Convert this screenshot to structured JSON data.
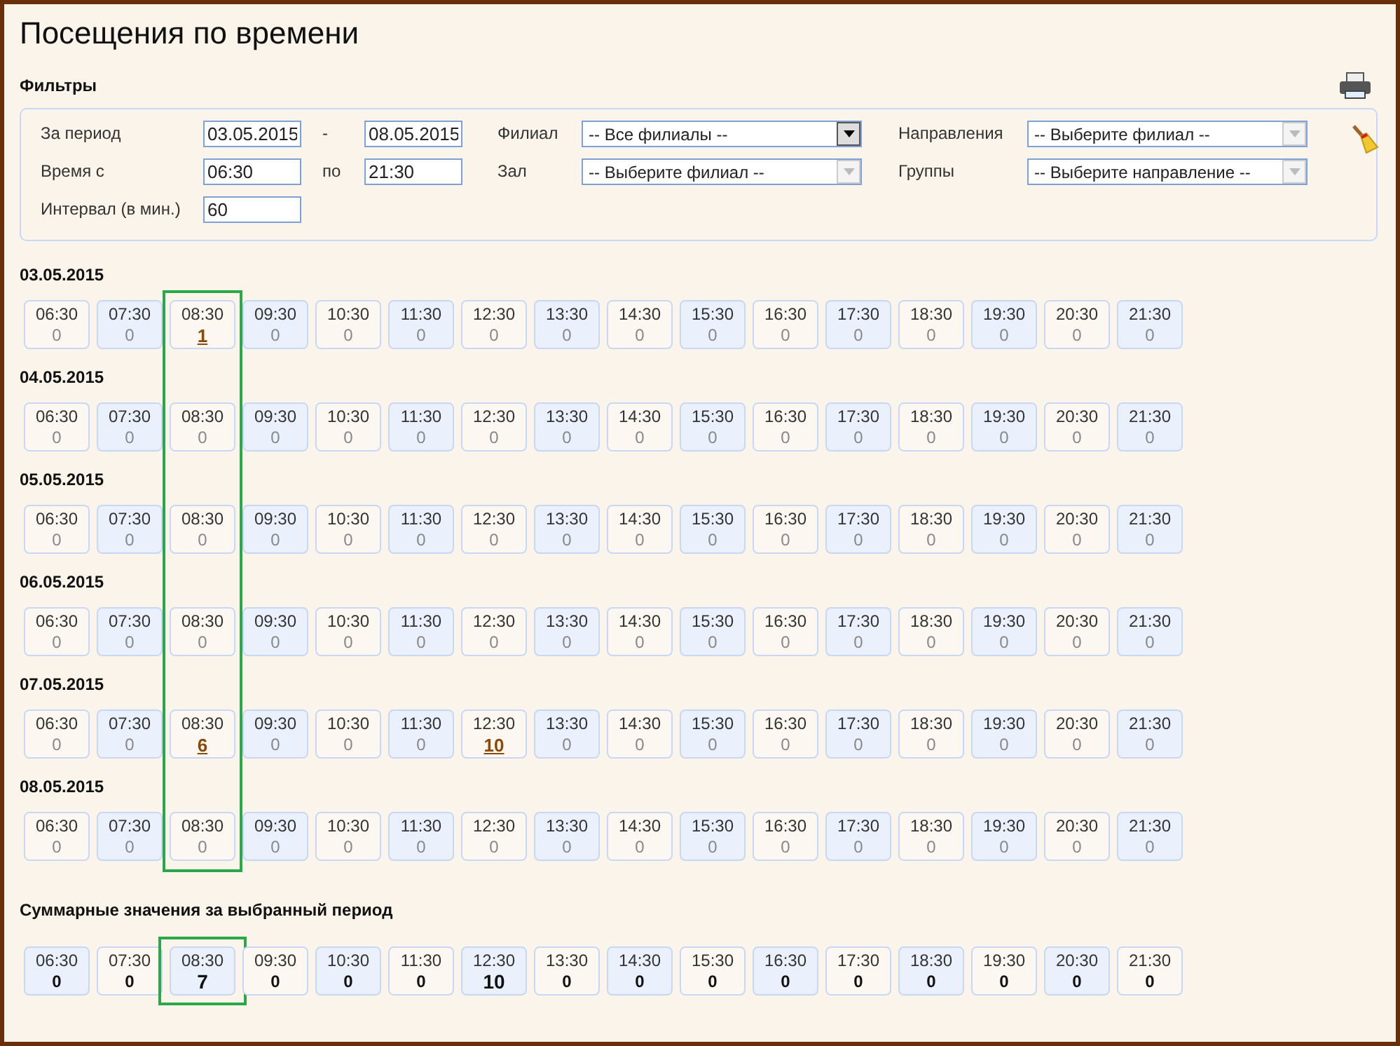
{
  "title": "Посещения по времени",
  "filters": {
    "heading": "Фильтры",
    "period_label": "За период",
    "period_from": "03.05.2015",
    "period_dash": "-",
    "period_to": "08.05.2015",
    "time_label": "Время с",
    "time_from": "06:30",
    "time_to_label": "по",
    "time_to": "21:30",
    "interval_label": "Интервал (в мин.)",
    "interval": "60",
    "branch_label": "Филиал",
    "branch": {
      "value": "-- Все филиалы --",
      "disabled": false
    },
    "hall_label": "Зал",
    "hall": {
      "value": "-- Выберите филиал --",
      "disabled": true
    },
    "direction_label": "Направления",
    "direction": {
      "value": "-- Выберите филиал --",
      "disabled": true
    },
    "groups_label": "Группы",
    "groups": {
      "value": "-- Выберите направление --",
      "disabled": true
    }
  },
  "days": [
    {
      "date": "03.05.2015",
      "slots": [
        {
          "time": "06:30",
          "count": "0",
          "linked": false,
          "highlighted": false
        },
        {
          "time": "07:30",
          "count": "0",
          "linked": false,
          "highlighted": false
        },
        {
          "time": "08:30",
          "count": "1",
          "linked": true,
          "highlighted": true
        },
        {
          "time": "09:30",
          "count": "0",
          "linked": false,
          "highlighted": false
        },
        {
          "time": "10:30",
          "count": "0",
          "linked": false,
          "highlighted": false
        },
        {
          "time": "11:30",
          "count": "0",
          "linked": false,
          "highlighted": false
        },
        {
          "time": "12:30",
          "count": "0",
          "linked": false,
          "highlighted": false
        },
        {
          "time": "13:30",
          "count": "0",
          "linked": false,
          "highlighted": false
        },
        {
          "time": "14:30",
          "count": "0",
          "linked": false,
          "highlighted": false
        },
        {
          "time": "15:30",
          "count": "0",
          "linked": false,
          "highlighted": false
        },
        {
          "time": "16:30",
          "count": "0",
          "linked": false,
          "highlighted": false
        },
        {
          "time": "17:30",
          "count": "0",
          "linked": false,
          "highlighted": false
        },
        {
          "time": "18:30",
          "count": "0",
          "linked": false,
          "highlighted": false
        },
        {
          "time": "19:30",
          "count": "0",
          "linked": false,
          "highlighted": false
        },
        {
          "time": "20:30",
          "count": "0",
          "linked": false,
          "highlighted": false
        },
        {
          "time": "21:30",
          "count": "0",
          "linked": false,
          "highlighted": false
        }
      ]
    },
    {
      "date": "04.05.2015",
      "slots": [
        {
          "time": "06:30",
          "count": "0",
          "linked": false,
          "highlighted": false
        },
        {
          "time": "07:30",
          "count": "0",
          "linked": false,
          "highlighted": false
        },
        {
          "time": "08:30",
          "count": "0",
          "linked": false,
          "highlighted": true
        },
        {
          "time": "09:30",
          "count": "0",
          "linked": false,
          "highlighted": false
        },
        {
          "time": "10:30",
          "count": "0",
          "linked": false,
          "highlighted": false
        },
        {
          "time": "11:30",
          "count": "0",
          "linked": false,
          "highlighted": false
        },
        {
          "time": "12:30",
          "count": "0",
          "linked": false,
          "highlighted": false
        },
        {
          "time": "13:30",
          "count": "0",
          "linked": false,
          "highlighted": false
        },
        {
          "time": "14:30",
          "count": "0",
          "linked": false,
          "highlighted": false
        },
        {
          "time": "15:30",
          "count": "0",
          "linked": false,
          "highlighted": false
        },
        {
          "time": "16:30",
          "count": "0",
          "linked": false,
          "highlighted": false
        },
        {
          "time": "17:30",
          "count": "0",
          "linked": false,
          "highlighted": false
        },
        {
          "time": "18:30",
          "count": "0",
          "linked": false,
          "highlighted": false
        },
        {
          "time": "19:30",
          "count": "0",
          "linked": false,
          "highlighted": false
        },
        {
          "time": "20:30",
          "count": "0",
          "linked": false,
          "highlighted": false
        },
        {
          "time": "21:30",
          "count": "0",
          "linked": false,
          "highlighted": false
        }
      ]
    },
    {
      "date": "05.05.2015",
      "slots": [
        {
          "time": "06:30",
          "count": "0",
          "linked": false,
          "highlighted": false
        },
        {
          "time": "07:30",
          "count": "0",
          "linked": false,
          "highlighted": false
        },
        {
          "time": "08:30",
          "count": "0",
          "linked": false,
          "highlighted": true
        },
        {
          "time": "09:30",
          "count": "0",
          "linked": false,
          "highlighted": false
        },
        {
          "time": "10:30",
          "count": "0",
          "linked": false,
          "highlighted": false
        },
        {
          "time": "11:30",
          "count": "0",
          "linked": false,
          "highlighted": false
        },
        {
          "time": "12:30",
          "count": "0",
          "linked": false,
          "highlighted": false
        },
        {
          "time": "13:30",
          "count": "0",
          "linked": false,
          "highlighted": false
        },
        {
          "time": "14:30",
          "count": "0",
          "linked": false,
          "highlighted": false
        },
        {
          "time": "15:30",
          "count": "0",
          "linked": false,
          "highlighted": false
        },
        {
          "time": "16:30",
          "count": "0",
          "linked": false,
          "highlighted": false
        },
        {
          "time": "17:30",
          "count": "0",
          "linked": false,
          "highlighted": false
        },
        {
          "time": "18:30",
          "count": "0",
          "linked": false,
          "highlighted": false
        },
        {
          "time": "19:30",
          "count": "0",
          "linked": false,
          "highlighted": false
        },
        {
          "time": "20:30",
          "count": "0",
          "linked": false,
          "highlighted": false
        },
        {
          "time": "21:30",
          "count": "0",
          "linked": false,
          "highlighted": false
        }
      ]
    },
    {
      "date": "06.05.2015",
      "slots": [
        {
          "time": "06:30",
          "count": "0",
          "linked": false,
          "highlighted": false
        },
        {
          "time": "07:30",
          "count": "0",
          "linked": false,
          "highlighted": false
        },
        {
          "time": "08:30",
          "count": "0",
          "linked": false,
          "highlighted": true
        },
        {
          "time": "09:30",
          "count": "0",
          "linked": false,
          "highlighted": false
        },
        {
          "time": "10:30",
          "count": "0",
          "linked": false,
          "highlighted": false
        },
        {
          "time": "11:30",
          "count": "0",
          "linked": false,
          "highlighted": false
        },
        {
          "time": "12:30",
          "count": "0",
          "linked": false,
          "highlighted": false
        },
        {
          "time": "13:30",
          "count": "0",
          "linked": false,
          "highlighted": false
        },
        {
          "time": "14:30",
          "count": "0",
          "linked": false,
          "highlighted": false
        },
        {
          "time": "15:30",
          "count": "0",
          "linked": false,
          "highlighted": false
        },
        {
          "time": "16:30",
          "count": "0",
          "linked": false,
          "highlighted": false
        },
        {
          "time": "17:30",
          "count": "0",
          "linked": false,
          "highlighted": false
        },
        {
          "time": "18:30",
          "count": "0",
          "linked": false,
          "highlighted": false
        },
        {
          "time": "19:30",
          "count": "0",
          "linked": false,
          "highlighted": false
        },
        {
          "time": "20:30",
          "count": "0",
          "linked": false,
          "highlighted": false
        },
        {
          "time": "21:30",
          "count": "0",
          "linked": false,
          "highlighted": false
        }
      ]
    },
    {
      "date": "07.05.2015",
      "slots": [
        {
          "time": "06:30",
          "count": "0",
          "linked": false,
          "highlighted": false
        },
        {
          "time": "07:30",
          "count": "0",
          "linked": false,
          "highlighted": false
        },
        {
          "time": "08:30",
          "count": "6",
          "linked": true,
          "highlighted": true
        },
        {
          "time": "09:30",
          "count": "0",
          "linked": false,
          "highlighted": false
        },
        {
          "time": "10:30",
          "count": "0",
          "linked": false,
          "highlighted": false
        },
        {
          "time": "11:30",
          "count": "0",
          "linked": false,
          "highlighted": false
        },
        {
          "time": "12:30",
          "count": "10",
          "linked": true,
          "highlighted": false
        },
        {
          "time": "13:30",
          "count": "0",
          "linked": false,
          "highlighted": false
        },
        {
          "time": "14:30",
          "count": "0",
          "linked": false,
          "highlighted": false
        },
        {
          "time": "15:30",
          "count": "0",
          "linked": false,
          "highlighted": false
        },
        {
          "time": "16:30",
          "count": "0",
          "linked": false,
          "highlighted": false
        },
        {
          "time": "17:30",
          "count": "0",
          "linked": false,
          "highlighted": false
        },
        {
          "time": "18:30",
          "count": "0",
          "linked": false,
          "highlighted": false
        },
        {
          "time": "19:30",
          "count": "0",
          "linked": false,
          "highlighted": false
        },
        {
          "time": "20:30",
          "count": "0",
          "linked": false,
          "highlighted": false
        },
        {
          "time": "21:30",
          "count": "0",
          "linked": false,
          "highlighted": false
        }
      ]
    },
    {
      "date": "08.05.2015",
      "slots": [
        {
          "time": "06:30",
          "count": "0",
          "linked": false,
          "highlighted": false
        },
        {
          "time": "07:30",
          "count": "0",
          "linked": false,
          "highlighted": false
        },
        {
          "time": "08:30",
          "count": "0",
          "linked": false,
          "highlighted": true
        },
        {
          "time": "09:30",
          "count": "0",
          "linked": false,
          "highlighted": false
        },
        {
          "time": "10:30",
          "count": "0",
          "linked": false,
          "highlighted": false
        },
        {
          "time": "11:30",
          "count": "0",
          "linked": false,
          "highlighted": false
        },
        {
          "time": "12:30",
          "count": "0",
          "linked": false,
          "highlighted": false
        },
        {
          "time": "13:30",
          "count": "0",
          "linked": false,
          "highlighted": false
        },
        {
          "time": "14:30",
          "count": "0",
          "linked": false,
          "highlighted": false
        },
        {
          "time": "15:30",
          "count": "0",
          "linked": false,
          "highlighted": false
        },
        {
          "time": "16:30",
          "count": "0",
          "linked": false,
          "highlighted": false
        },
        {
          "time": "17:30",
          "count": "0",
          "linked": false,
          "highlighted": false
        },
        {
          "time": "18:30",
          "count": "0",
          "linked": false,
          "highlighted": false
        },
        {
          "time": "19:30",
          "count": "0",
          "linked": false,
          "highlighted": false
        },
        {
          "time": "20:30",
          "count": "0",
          "linked": false,
          "highlighted": false
        },
        {
          "time": "21:30",
          "count": "0",
          "linked": false,
          "highlighted": false
        }
      ]
    }
  ],
  "summary": {
    "heading": "Суммарные значения за выбранный период",
    "slots": [
      {
        "time": "06:30",
        "count": "0",
        "highlighted": false
      },
      {
        "time": "07:30",
        "count": "0",
        "highlighted": false
      },
      {
        "time": "08:30",
        "count": "7",
        "highlighted": true
      },
      {
        "time": "09:30",
        "count": "0",
        "highlighted": false
      },
      {
        "time": "10:30",
        "count": "0",
        "highlighted": false
      },
      {
        "time": "11:30",
        "count": "0",
        "highlighted": false
      },
      {
        "time": "12:30",
        "count": "10",
        "highlighted": false
      },
      {
        "time": "13:30",
        "count": "0",
        "highlighted": false
      },
      {
        "time": "14:30",
        "count": "0",
        "highlighted": false
      },
      {
        "time": "15:30",
        "count": "0",
        "highlighted": false
      },
      {
        "time": "16:30",
        "count": "0",
        "highlighted": false
      },
      {
        "time": "17:30",
        "count": "0",
        "highlighted": false
      },
      {
        "time": "18:30",
        "count": "0",
        "highlighted": false
      },
      {
        "time": "19:30",
        "count": "0",
        "highlighted": false
      },
      {
        "time": "20:30",
        "count": "0",
        "highlighted": false
      },
      {
        "time": "21:30",
        "count": "0",
        "highlighted": false
      }
    ]
  }
}
